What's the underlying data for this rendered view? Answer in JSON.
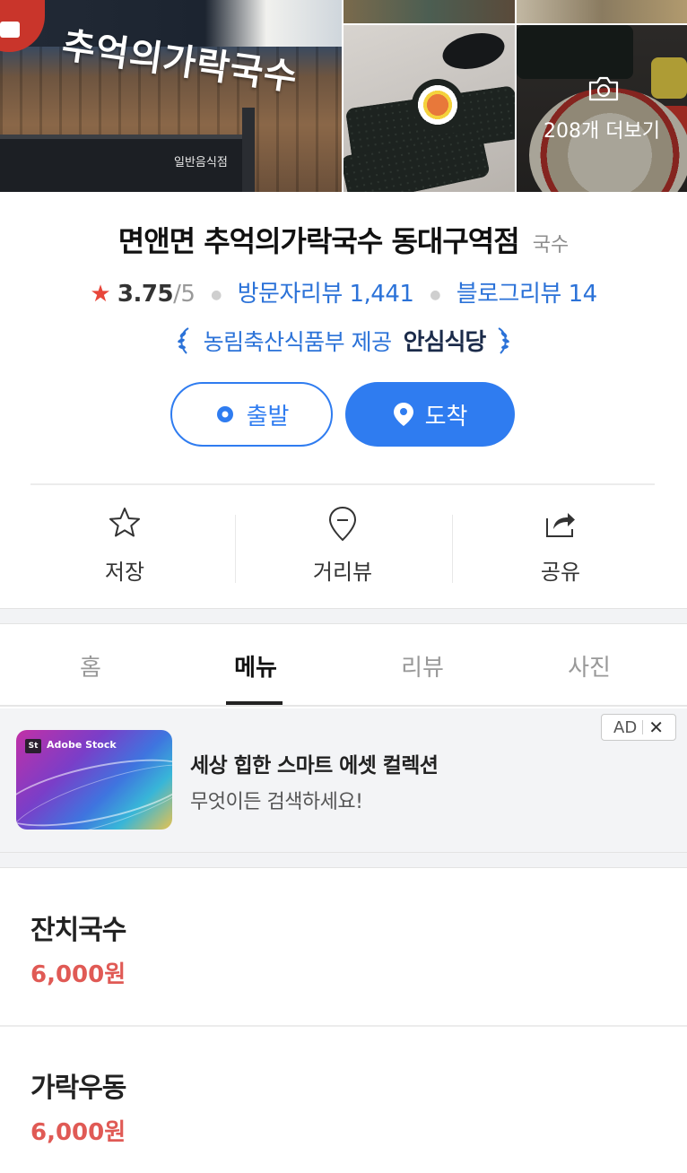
{
  "photos": {
    "main_sign": "추억의가락국수",
    "main_sub": "일반음식점",
    "more_label": "208개 더보기"
  },
  "place": {
    "name": "면앤면 추억의가락국수 동대구역점",
    "category": "국수",
    "rating": "3.75",
    "rating_max": "/5",
    "visitor_reviews": "방문자리뷰 1,441",
    "blog_reviews": "블로그리뷰 14",
    "safe_provider": "농림축산식품부 제공",
    "safe_badge": "안심식당",
    "accent_color": "#2f7cf0",
    "star_color": "#e8463a"
  },
  "buttons": {
    "start": "출발",
    "arrive": "도착"
  },
  "actions": [
    {
      "label": "저장",
      "icon": "star-outline-icon"
    },
    {
      "label": "거리뷰",
      "icon": "streetview-pin-icon"
    },
    {
      "label": "공유",
      "icon": "share-icon"
    }
  ],
  "tabs": [
    "홈",
    "메뉴",
    "리뷰",
    "사진"
  ],
  "active_tab": "메뉴",
  "ad": {
    "brand": "Adobe Stock",
    "brand_short": "St",
    "title": "세상 힙한 스마트 에셋 컬렉션",
    "subtitle": "무엇이든 검색하세요!",
    "badge": "AD",
    "close": "✕"
  },
  "menu": [
    {
      "name": "잔치국수",
      "price": "6,000원"
    },
    {
      "name": "가락우동",
      "price": "6,000원"
    }
  ]
}
